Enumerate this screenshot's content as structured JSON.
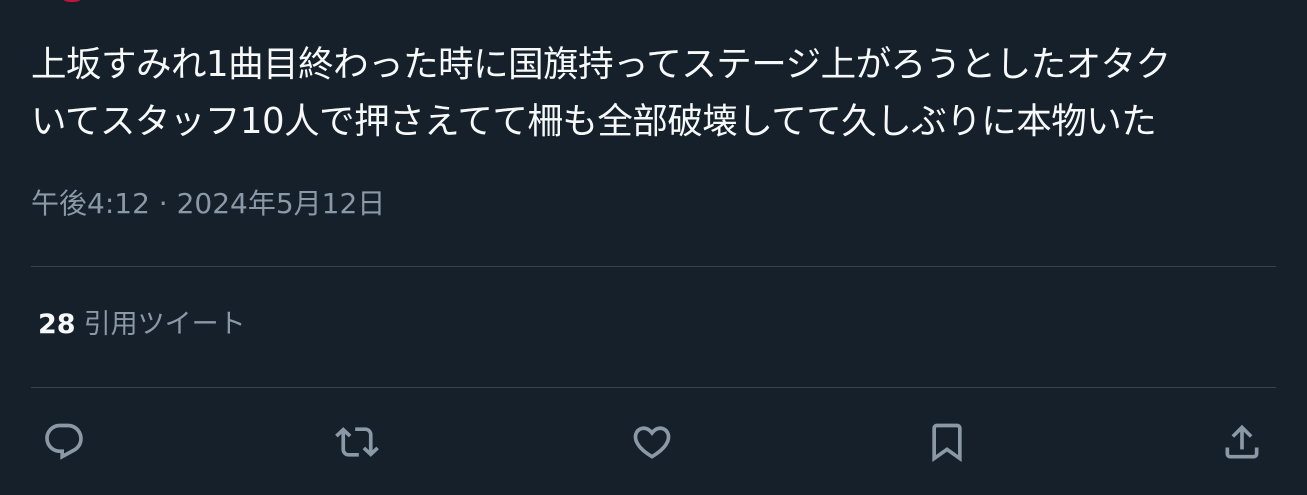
{
  "tweet": {
    "text_lines": [
      "上坂すみれ1曲目終わった時に国旗持ってステージ上がろうとしたオタク",
      "いてスタッフ10人で押さえてて柵も全部破壊してて久しぶりに本物いた"
    ],
    "time": "午後4:12",
    "separator": "·",
    "date": "2024年5月12日"
  },
  "stats": {
    "quote_count": "28",
    "quote_label": "引用ツイート"
  },
  "actions": {
    "reply_icon": "reply-icon",
    "retweet_icon": "retweet-icon",
    "like_icon": "heart-icon",
    "bookmark_icon": "bookmark-icon",
    "share_icon": "share-icon"
  },
  "colors": {
    "background": "#15202b",
    "text": "#f7f9f9",
    "secondary_text": "#8b98a5",
    "divider": "#38444d",
    "avatar_accent": "#c4143e"
  }
}
